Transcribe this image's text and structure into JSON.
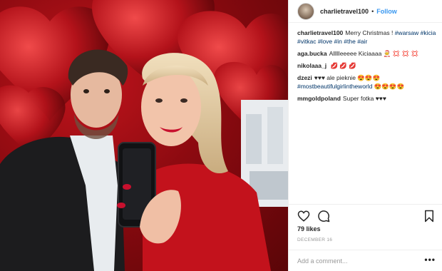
{
  "post": {
    "username": "charlietravel100",
    "separator": "•",
    "follow_label": "Follow",
    "likes": "79 likes",
    "date": "DECEMBER 16",
    "add_comment_placeholder": "Add a comment...",
    "more_label": "•••"
  },
  "caption": {
    "user": "charlietravel100",
    "text": "Merry Christmas ! ",
    "tags": [
      "#warsaw",
      "#kicia",
      "#vitkac",
      "#love",
      "#in",
      "#the",
      "#air"
    ]
  },
  "comments": [
    {
      "user": "aga.bucka",
      "text": "Allllleeeee Kiciaaaa",
      "emoji": "🧑‍🎄 💢 💢 💢"
    },
    {
      "user": "nikolaaa_j",
      "text": "",
      "emoji": "💋 💋 💋"
    },
    {
      "user": "dzezi",
      "text": "♥♥♥ ale pieknie",
      "emoji": "😍😍😍",
      "tag": "#mostbeautifulgirlintheworld",
      "tag_emoji": "😍😍😍😍"
    },
    {
      "user": "mmgoldpoland",
      "text": "Super fotka ♥♥♥",
      "emoji": ""
    }
  ],
  "icons": {
    "like": "heart-icon",
    "comment": "comment-icon",
    "save": "bookmark-icon",
    "avatar": "avatar",
    "more": "more-options-icon"
  },
  "colors": {
    "link": "#3897f0",
    "hashtag": "#003569",
    "text": "#262626",
    "muted": "#999999",
    "photo_red": "#b3121a"
  }
}
